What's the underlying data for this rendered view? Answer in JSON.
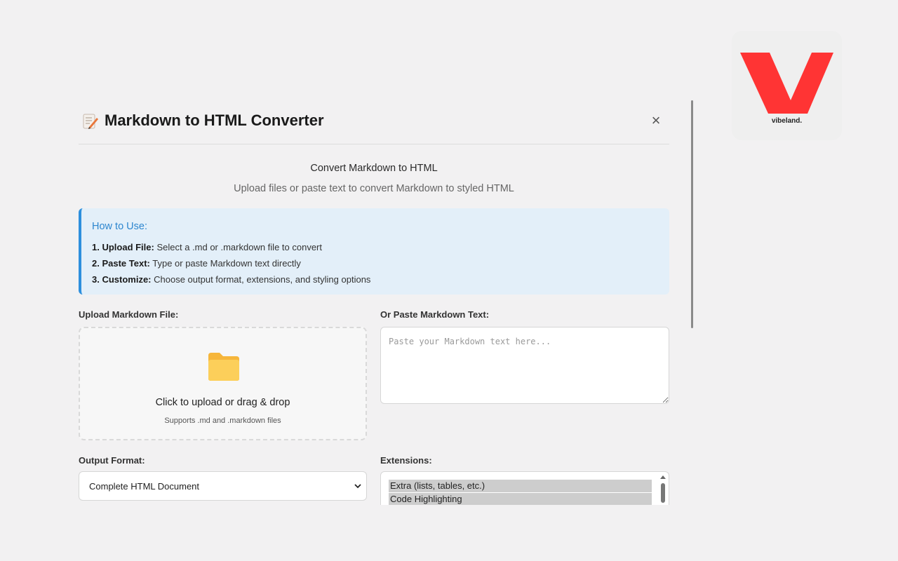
{
  "brand": {
    "logo_text": "vibeland.",
    "accent": "#ff3b30"
  },
  "dialog": {
    "title": "Markdown to HTML Converter",
    "title_icon": "memo-icon",
    "close_label": "×"
  },
  "intro": {
    "heading": "Convert Markdown to HTML",
    "subtext": "Upload files or paste text to convert Markdown to styled HTML"
  },
  "how_to": {
    "title": "How to Use:",
    "steps": [
      {
        "label": "1. Upload File:",
        "text": " Select a .md or .markdown file to convert"
      },
      {
        "label": "2. Paste Text:",
        "text": " Type or paste Markdown text directly"
      },
      {
        "label": "3. Customize:",
        "text": " Choose output format, extensions, and styling options"
      }
    ],
    "accent": "#2d8fdd"
  },
  "upload": {
    "label": "Upload Markdown File:",
    "main_text": "Click to upload or drag & drop",
    "sub_text": "Supports .md and .markdown files",
    "icon": "folder-icon"
  },
  "paste": {
    "label": "Or Paste Markdown Text:",
    "placeholder": "Paste your Markdown text here..."
  },
  "output": {
    "label": "Output Format:",
    "selected": "Complete HTML Document"
  },
  "extensions": {
    "label": "Extensions:",
    "items": [
      "Extra (lists, tables, etc.)",
      "Code Highlighting"
    ]
  }
}
